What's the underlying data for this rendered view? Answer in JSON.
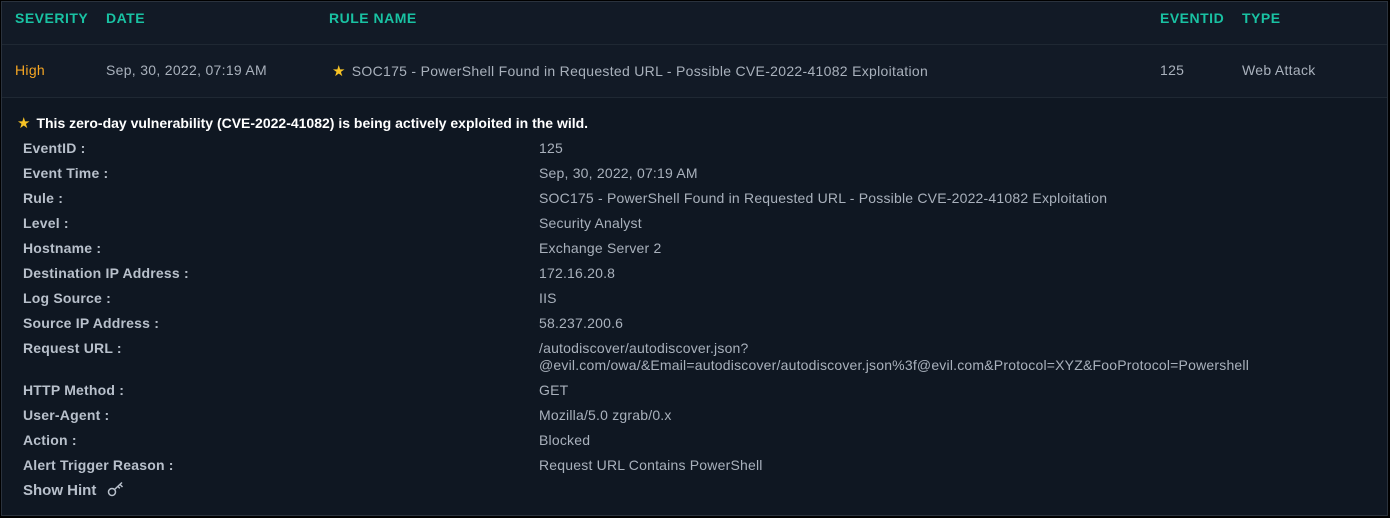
{
  "header": {
    "severity": "SEVERITY",
    "date": "DATE",
    "rule_name": "RULE NAME",
    "eventid": "EVENTID",
    "type": "TYPE"
  },
  "row": {
    "severity": "High",
    "date": "Sep, 30, 2022, 07:19 AM",
    "rule_name": "SOC175 - PowerShell Found in Requested URL - Possible CVE-2022-41082 Exploitation",
    "eventid": "125",
    "type": "Web Attack",
    "icon": "star-icon"
  },
  "details": {
    "note": "This zero-day vulnerability (CVE-2022-41082) is being actively exploited in the wild.",
    "fields": [
      {
        "label": "EventID :",
        "value": "125"
      },
      {
        "label": "Event Time :",
        "value": "Sep, 30, 2022, 07:19 AM"
      },
      {
        "label": "Rule :",
        "value": "SOC175 - PowerShell Found in Requested URL - Possible CVE-2022-41082 Exploitation"
      },
      {
        "label": "Level :",
        "value": "Security Analyst"
      },
      {
        "label": "Hostname :",
        "value": "Exchange Server 2"
      },
      {
        "label": "Destination IP Address :",
        "value": "172.16.20.8"
      },
      {
        "label": "Log Source :",
        "value": "IIS"
      },
      {
        "label": "Source IP Address :",
        "value": "58.237.200.6"
      },
      {
        "label": "Request URL :",
        "value_line1": "/autodiscover/autodiscover.json?",
        "value_line2": "@evil.com/owa/&Email=autodiscover/autodiscover.json%3f@evil.com&Protocol=XYZ&FooProtocol=Powershell"
      },
      {
        "label": "HTTP Method :",
        "value": "GET"
      },
      {
        "label": "User-Agent :",
        "value": "Mozilla/5.0 zgrab/0.x"
      },
      {
        "label": "Action :",
        "value": "Blocked"
      },
      {
        "label": "Alert Trigger Reason :",
        "value": "Request URL Contains PowerShell"
      }
    ],
    "show_hint": "Show Hint",
    "hint_icon": "key-icon"
  },
  "colors": {
    "accent": "#19c2a3",
    "severity_high": "#f5a623",
    "star": "#f7c325",
    "background": "#121a26"
  }
}
